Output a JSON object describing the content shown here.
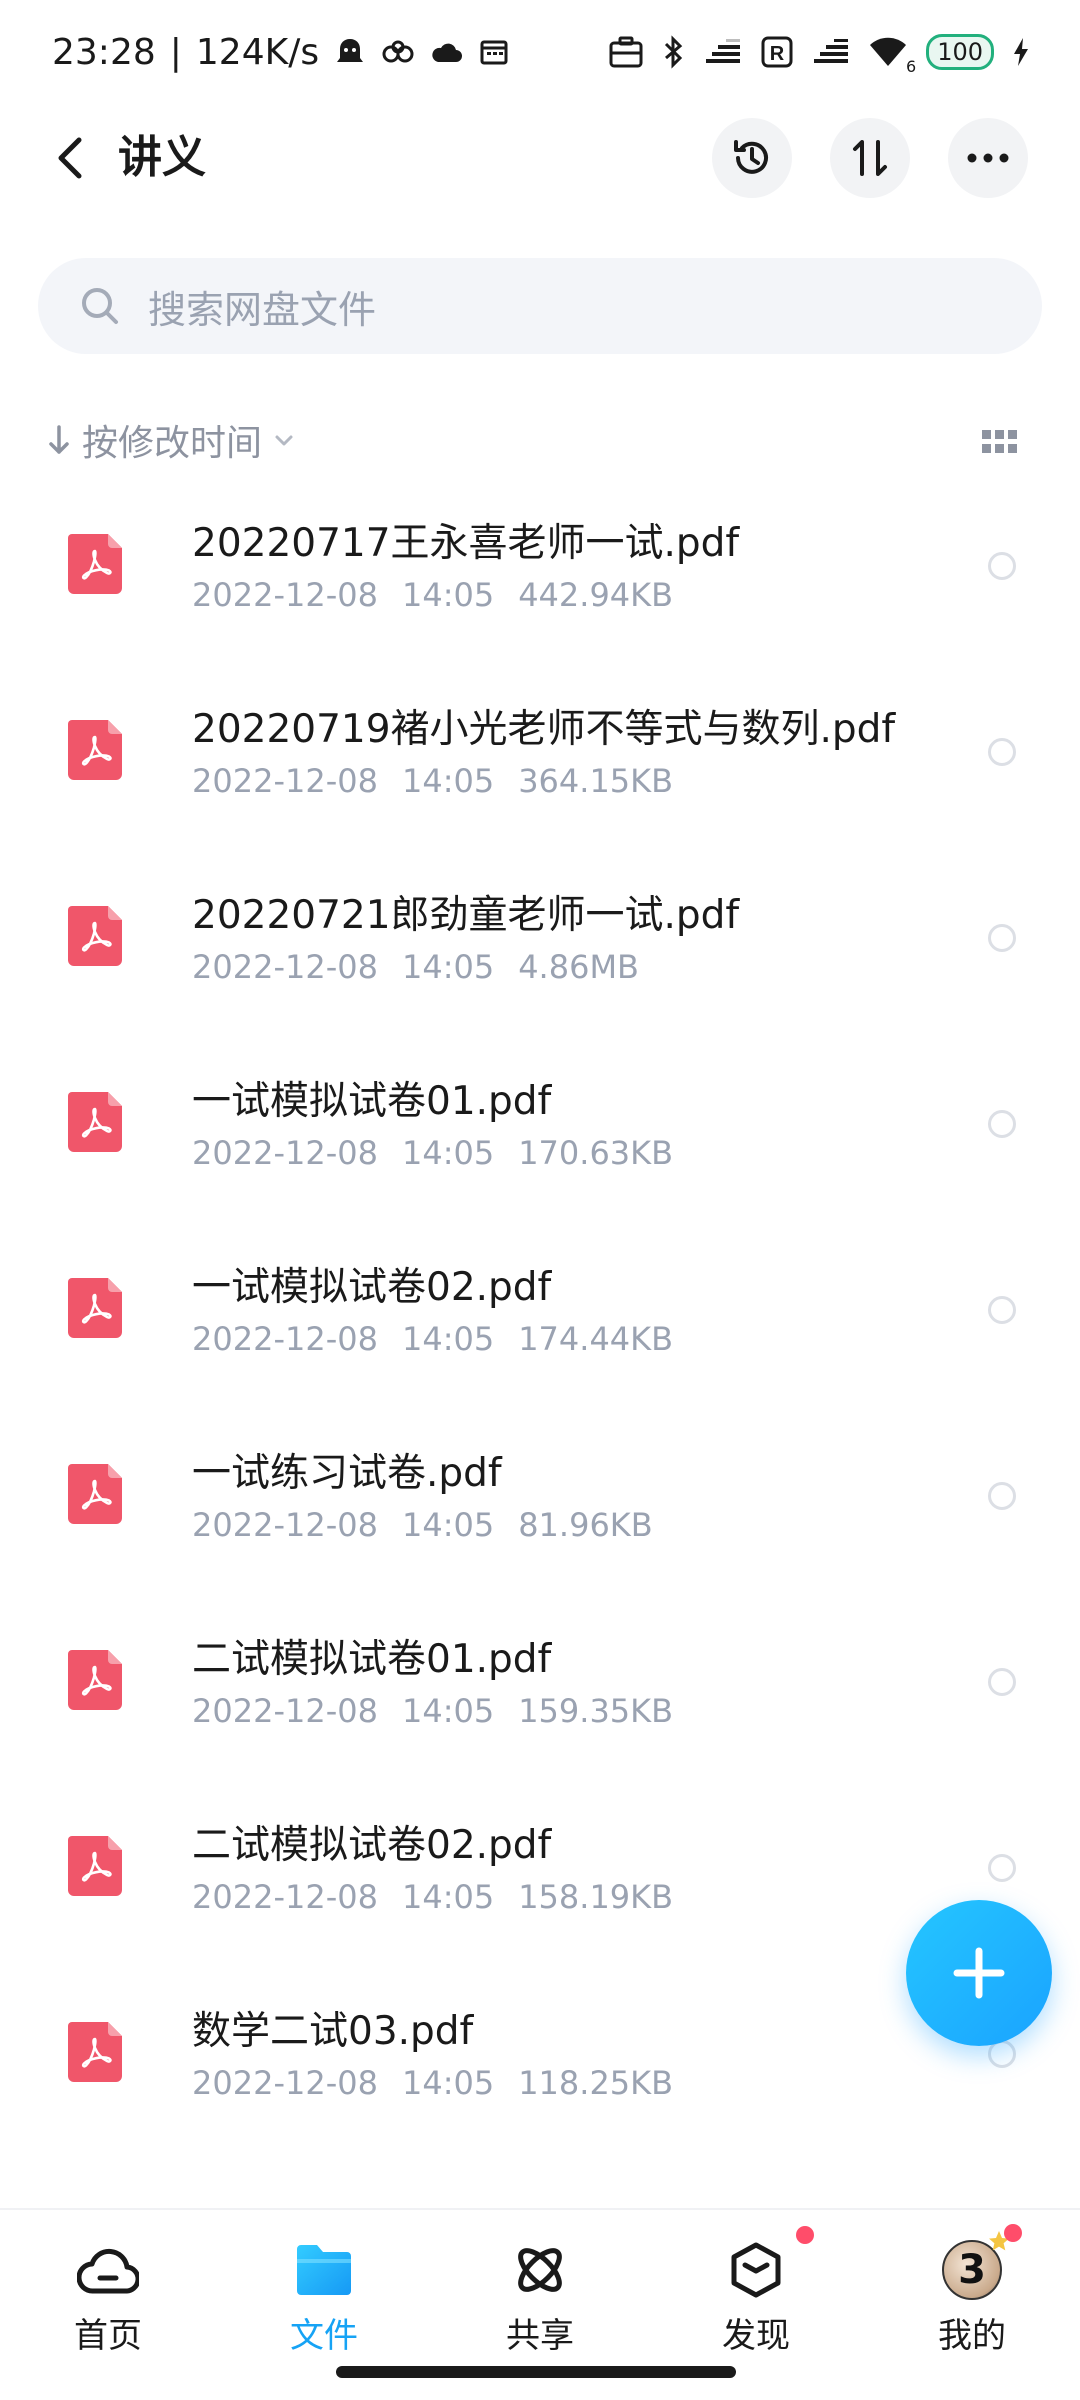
{
  "status_bar": {
    "time": "23:28",
    "network_speed": "124K/s",
    "battery": "100",
    "wifi_sub": "6",
    "icons": [
      "bell-icon",
      "infinity-icon",
      "cloud-icon",
      "calendar-icon",
      "briefcase-icon",
      "bluetooth-icon",
      "signal-icon",
      "r-icon",
      "signal-icon",
      "wifi-icon",
      "charging-icon"
    ]
  },
  "header": {
    "title": "讲义",
    "actions": [
      "history-icon",
      "sort-transfer-icon",
      "more-icon"
    ]
  },
  "search": {
    "placeholder": "搜索网盘文件"
  },
  "sort": {
    "label": "按修改时间"
  },
  "files": [
    {
      "name": "20220717王永喜老师一试.pdf",
      "date": "2022-12-08",
      "time": "14:05",
      "size": "442.94KB"
    },
    {
      "name": "20220719褚小光老师不等式与数列.pdf",
      "date": "2022-12-08",
      "time": "14:05",
      "size": "364.15KB"
    },
    {
      "name": "20220721郎劲童老师一试.pdf",
      "date": "2022-12-08",
      "time": "14:05",
      "size": "4.86MB"
    },
    {
      "name": "一试模拟试卷01.pdf",
      "date": "2022-12-08",
      "time": "14:05",
      "size": "170.63KB"
    },
    {
      "name": "一试模拟试卷02.pdf",
      "date": "2022-12-08",
      "time": "14:05",
      "size": "174.44KB"
    },
    {
      "name": "一试练习试卷.pdf",
      "date": "2022-12-08",
      "time": "14:05",
      "size": "81.96KB"
    },
    {
      "name": "二试模拟试卷01.pdf",
      "date": "2022-12-08",
      "time": "14:05",
      "size": "159.35KB"
    },
    {
      "name": "二试模拟试卷02.pdf",
      "date": "2022-12-08",
      "time": "14:05",
      "size": "158.19KB"
    },
    {
      "name": "数学二试03.pdf",
      "date": "2022-12-08",
      "time": "14:05",
      "size": "118.25KB"
    }
  ],
  "bottom_nav": {
    "items": [
      {
        "label": "首页",
        "icon": "cloud-home-icon"
      },
      {
        "label": "文件",
        "icon": "folder-icon"
      },
      {
        "label": "共享",
        "icon": "atom-icon"
      },
      {
        "label": "发现",
        "icon": "cube-icon"
      },
      {
        "label": "我的",
        "icon": "avatar"
      }
    ],
    "avatar_text": "3"
  },
  "colors": {
    "accent": "#16a3f5",
    "pdf_red": "#f0566a",
    "meta_gray": "#9aa2b1",
    "badge_red": "#ff4d6a"
  }
}
